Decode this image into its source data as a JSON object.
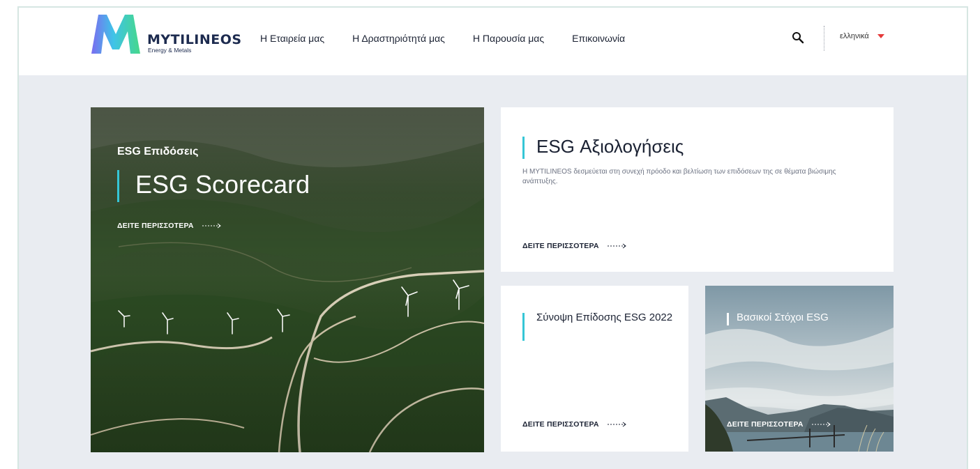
{
  "header": {
    "logo_name": "MYTILINEOS",
    "logo_sub": "Energy & Metals",
    "nav": [
      {
        "label": "Η Εταιρεία μας"
      },
      {
        "label": "Η Δραστηριότητά μας"
      },
      {
        "label": "Η Παρουσία μας"
      },
      {
        "label": "Επικοινωνία"
      }
    ],
    "language": "ελληνικά",
    "search_icon": "search-icon",
    "accent_color": "#e53a3a"
  },
  "hero": {
    "eyebrow": "ESG Επιδόσεις",
    "title": "ESG Scorecard",
    "more": "ΔΕΙΤΕ ΠΕΡΙΣΣΟΤΕΡΑ"
  },
  "esg_card": {
    "title": "ESG Αξιολογήσεις",
    "description": "Η MYTILINEOS δεσμεύεται στη συνεχή πρόοδο και βελτίωση των επιδόσεων της σε θέματα βιώσιμης ανάπτυξης.",
    "more": "ΔΕΙΤΕ ΠΕΡΙΣΣΟΤΕΡΑ"
  },
  "summary_card": {
    "title": "Σύνοψη Επίδοσης ESG 2022",
    "more": "ΔΕΙΤΕ ΠΕΡΙΣΣΟΤΕΡΑ"
  },
  "goals_card": {
    "title": "Βασικοί Στόχοι ESG",
    "more": "ΔΕΙΤΕ ΠΕΡΙΣΣΟΤΕΡΑ"
  },
  "colors": {
    "accent_bar": "#35c6d6",
    "page_bg": "#e9ecf1"
  }
}
